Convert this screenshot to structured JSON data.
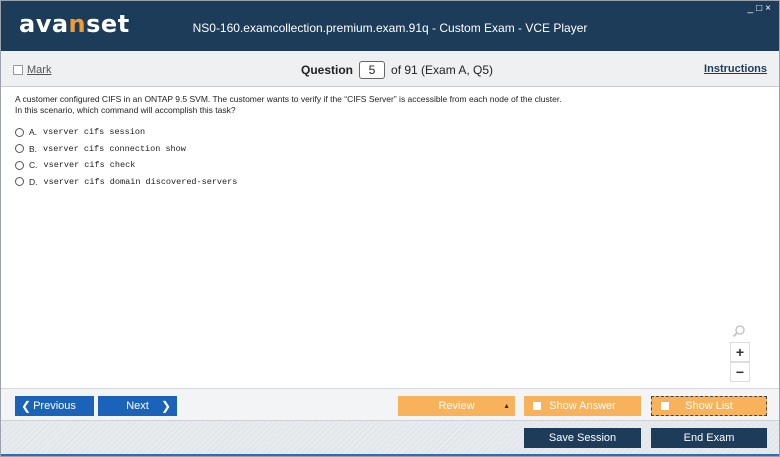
{
  "app": {
    "logo_prefix": "ava",
    "logo_accent": "n",
    "logo_suffix": "set",
    "window_title": "NS0-160.examcollection.premium.exam.91q - Custom Exam - VCE Player",
    "window_controls": [
      "_",
      "□",
      "×"
    ]
  },
  "toolbar": {
    "mark_label": "Mark",
    "question_label": "Question",
    "question_number": "5",
    "question_of": "of 91 (Exam A, Q5)",
    "instructions_label": "Instructions"
  },
  "question": {
    "line1": "A customer configured CIFS in an ONTAP 9.5 SVM. The customer wants to verify if the “CIFS Server” is accessible from each node of the cluster.",
    "line2": "In this scenario, which command will accomplish this task?",
    "options": [
      {
        "letter": "A.",
        "text": "vserver cifs session"
      },
      {
        "letter": "B.",
        "text": "vserver cifs connection show"
      },
      {
        "letter": "C.",
        "text": "vserver cifs check"
      },
      {
        "letter": "D.",
        "text": "vserver cifs domain discovered-servers"
      }
    ]
  },
  "zoom": {
    "in": "+",
    "out": "−"
  },
  "nav": {
    "previous": "Previous",
    "next": "Next",
    "review": "Review",
    "show_answer": "Show Answer",
    "show_list": "Show List"
  },
  "footer": {
    "save_session": "Save Session",
    "end_exam": "End Exam"
  },
  "colors": {
    "titlebar": "#1d3c5a",
    "accent_orange": "#f29b30",
    "nav_blue": "#1b63b8",
    "button_orange": "#f8b25c"
  }
}
